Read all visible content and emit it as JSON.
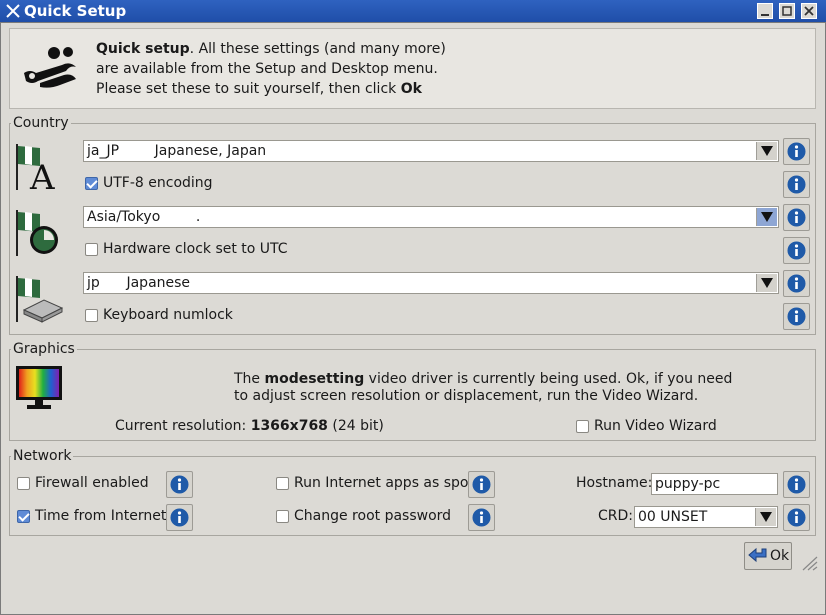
{
  "window": {
    "title": "Quick Setup"
  },
  "header": {
    "bold_lead": "Quick setup",
    "line1_rest": ". All these settings (and many more)",
    "line2": "are available from the Setup and Desktop menu.",
    "line3_pre": "Please set these to suit yourself, then click ",
    "line3_bold": "Ok"
  },
  "country": {
    "label": "Country",
    "locale_value": "ja_JP        Japanese, Japan",
    "utf8_label": "UTF-8 encoding",
    "utf8_checked": true,
    "timezone_value": "Asia/Tokyo        .",
    "hwclock_label": "Hardware clock set to UTC",
    "hwclock_checked": false,
    "keyboard_value": "jp      Japanese",
    "numlock_label": "Keyboard numlock",
    "numlock_checked": false
  },
  "graphics": {
    "label": "Graphics",
    "driver_pre": "The ",
    "driver_bold": "modesetting",
    "driver_post": " video driver is currently being used. Ok, if you need",
    "driver_line2": "to adjust screen resolution or displacement, run the Video Wizard.",
    "res_label": "Current resolution: ",
    "res_value": "1366x768",
    "res_depth": "  (24 bit)",
    "wizard_label": "Run Video Wizard",
    "wizard_checked": false
  },
  "network": {
    "label": "Network",
    "firewall_label": "Firewall enabled",
    "firewall_checked": false,
    "time_label": "Time from Internet",
    "time_checked": true,
    "spot_label": "Run Internet apps as spot",
    "spot_checked": false,
    "rootpw_label": "Change root password",
    "rootpw_checked": false,
    "hostname_label": "Hostname:",
    "hostname_value": "puppy-pc",
    "crd_label": "CRD:",
    "crd_value": "00 UNSET"
  },
  "footer": {
    "ok_label": "Ok"
  },
  "colors": {
    "titlebar": "#2f62c0",
    "info_icon": "#1f5aa8",
    "check_on": "#5f8bd6"
  },
  "icons": [
    "tools-icon",
    "info-icon",
    "flag-locale-icon",
    "flag-clock-icon",
    "flag-keyboard-icon",
    "monitor-icon",
    "ok-arrow-icon"
  ]
}
